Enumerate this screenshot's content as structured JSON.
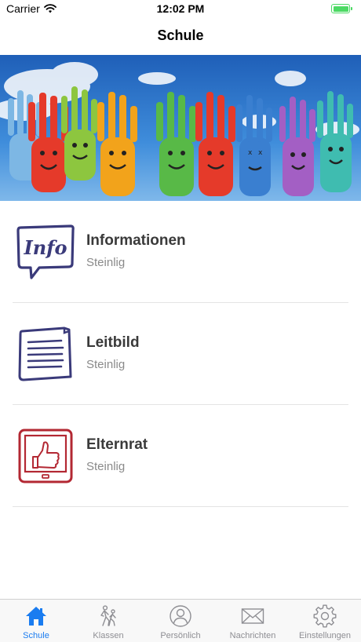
{
  "status_bar": {
    "carrier": "Carrier",
    "time": "12:02 PM",
    "battery_level": 1.0
  },
  "nav": {
    "title": "Schule"
  },
  "colors": {
    "accent": "#1a7cf0",
    "inactive": "#8e8e93",
    "navy": "#3a3a7a",
    "red": "#b32833",
    "battery": "#4cd964"
  },
  "items": [
    {
      "title": "Informationen",
      "subtitle": "Steinlig",
      "icon": "info-speech-bubble-icon"
    },
    {
      "title": "Leitbild",
      "subtitle": "Steinlig",
      "icon": "document-icon"
    },
    {
      "title": "Elternrat",
      "subtitle": "Steinlig",
      "icon": "thumbs-up-tablet-icon"
    }
  ],
  "tabs": [
    {
      "label": "Schule",
      "icon": "house-icon",
      "active": true
    },
    {
      "label": "Klassen",
      "icon": "walking-people-icon",
      "active": false
    },
    {
      "label": "Persönlich",
      "icon": "person-icon",
      "active": false
    },
    {
      "label": "Nachrichten",
      "icon": "envelope-icon",
      "active": false
    },
    {
      "label": "Einstellungen",
      "icon": "gear-icon",
      "active": false
    }
  ]
}
